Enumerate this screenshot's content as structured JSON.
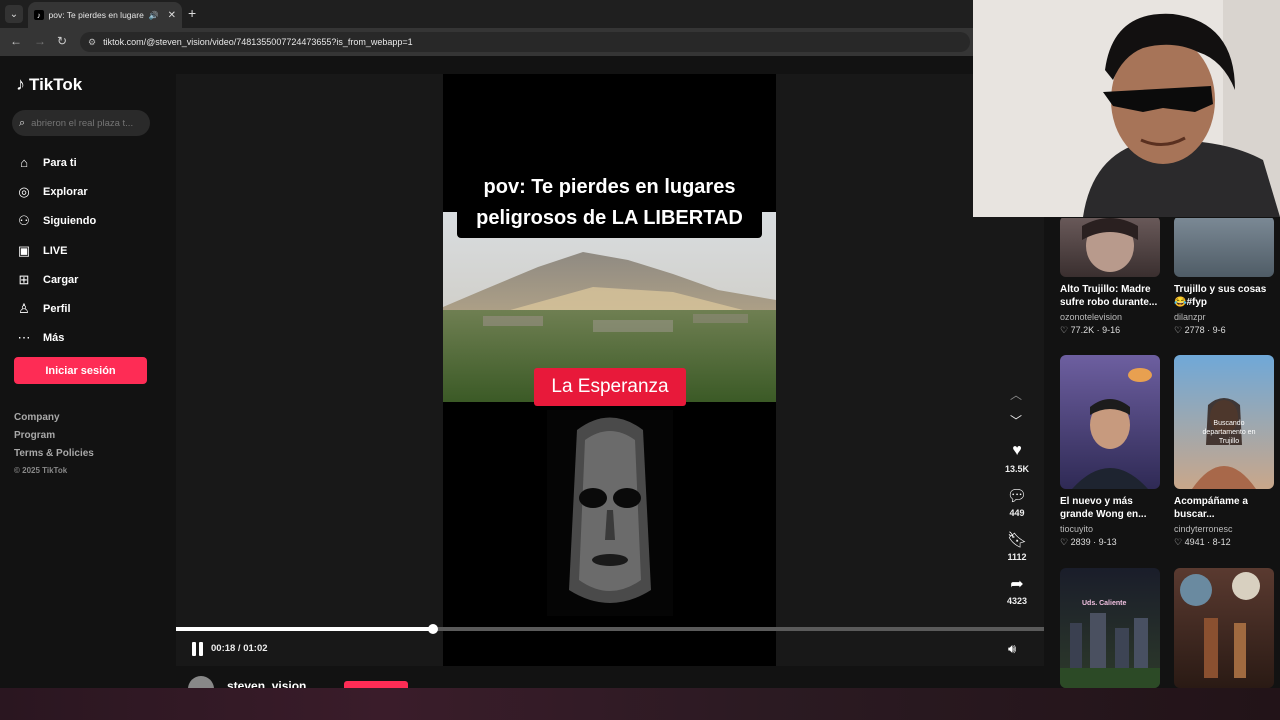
{
  "browser": {
    "tab_title": "pov: Te pierdes en lugares p",
    "url": "tiktok.com/@steven_vision/video/7481355007724473655?is_from_webapp=1"
  },
  "sidebar": {
    "logo": "TikTok",
    "search_placeholder": "abrieron el real plaza t...",
    "items": [
      {
        "label": "Para ti",
        "icon": "home-icon"
      },
      {
        "label": "Explorar",
        "icon": "compass-icon"
      },
      {
        "label": "Siguiendo",
        "icon": "following-icon"
      },
      {
        "label": "LIVE",
        "icon": "live-icon"
      },
      {
        "label": "Cargar",
        "icon": "upload-icon"
      },
      {
        "label": "Perfil",
        "icon": "profile-icon"
      },
      {
        "label": "Más",
        "icon": "more-icon"
      }
    ],
    "login_label": "Iniciar sesión",
    "footer": [
      "Company",
      "Program",
      "Terms & Policies"
    ],
    "copyright": "© 2025 TikTok"
  },
  "video": {
    "caption_line1": "pov: Te pierdes en lugares",
    "caption_line2": "peligrosos de LA LIBERTAD",
    "place_label": "La Esperanza",
    "time": "00:18 / 01:02",
    "progress": 0.296,
    "author": "steven_vision"
  },
  "actions": {
    "likes": "13.5K",
    "comments": "449",
    "saves": "1112",
    "shares": "4323"
  },
  "related": [
    {
      "title": "Alto Trujillo: Madre sufre robo durante...",
      "author": "ozonotelevision",
      "meta": "♡ 77.2K · 9-16"
    },
    {
      "title": "Trujillo y sus cosas 😂#fyp",
      "author": "dilanzpr",
      "meta": "♡ 2778 · 9-6"
    },
    {
      "title": "El nuevo y más grande Wong en...",
      "author": "tiocuyito",
      "meta": "♡ 2839 · 9-13"
    },
    {
      "title": "Acompáñame a buscar...",
      "author": "cindyterronesc",
      "meta": "♡ 4941 · 8-12"
    },
    {
      "overlay": "Uds. Caliente",
      "title": "",
      "author": "",
      "meta": ""
    },
    {
      "title": "",
      "author": "",
      "meta": ""
    }
  ],
  "thumb_overlay_4": "Buscando departamento en Trujillo",
  "colors": {
    "accent": "#fe2c55",
    "background": "#121212"
  }
}
